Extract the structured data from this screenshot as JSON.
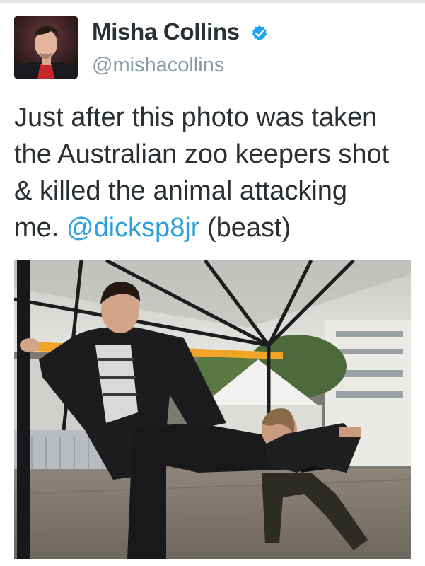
{
  "tweet": {
    "display_name": "Misha Collins",
    "handle": "@mishacollins",
    "text_lines": [
      "Just after this photo was taken",
      "the Australian zoo keepers shot",
      "& killed the animal attacking"
    ],
    "last_line_prefix": "me. ",
    "mention": "@dicksp8jr",
    "last_line_suffix": " (beast)",
    "verified": true
  },
  "colors": {
    "name": "#292f33",
    "handle": "#8899a6",
    "mention": "#2b9fdf",
    "verified_badge": "#1da1f2"
  },
  "icons": {
    "verified": "verified-badge-icon"
  }
}
